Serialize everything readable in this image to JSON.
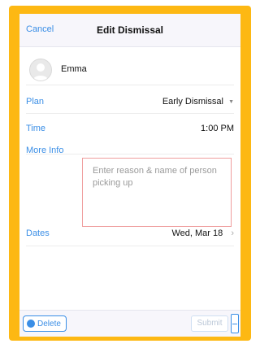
{
  "header": {
    "cancel_label": "Cancel",
    "title": "Edit Dismissal"
  },
  "student": {
    "name": "Emma"
  },
  "form": {
    "plan_label": "Plan",
    "plan_value": "Early Dismissal",
    "time_label": "Time",
    "time_value": "1:00 PM",
    "more_info_label": "More Info",
    "more_info_placeholder": "Enter reason & name of person picking up",
    "more_info_value": "",
    "dates_label": "Dates",
    "dates_value": "Wed, Mar 18"
  },
  "footer": {
    "delete_label": "Delete",
    "submit_label": "Submit"
  },
  "colors": {
    "frame": "#FDB813",
    "accent": "#3a8ee6",
    "textarea_border": "#ef9d9d"
  },
  "icons": {
    "avatar": "person-avatar-icon",
    "plan_dropdown": "caret-down-icon",
    "dates_chevron": "chevron-right-icon",
    "delete": "circle-icon",
    "more": "more-icon"
  }
}
